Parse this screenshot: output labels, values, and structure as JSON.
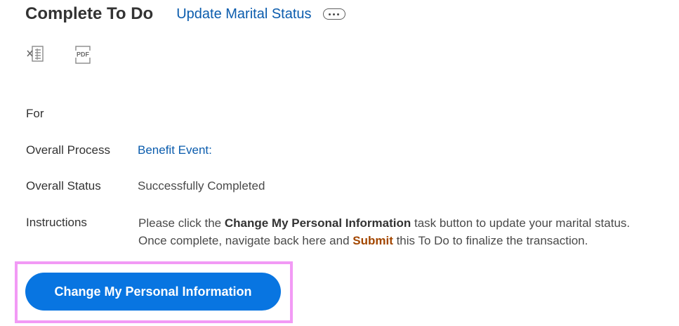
{
  "header": {
    "title": "Complete To Do",
    "subject_link": "Update Marital Status",
    "related_actions_icon": "more-horizontal-icon"
  },
  "export": {
    "excel_icon": "export-to-excel-icon",
    "pdf_icon": "export-to-pdf-icon",
    "pdf_icon_text": "PDF"
  },
  "fields": {
    "for_label": "For",
    "for_value": "",
    "overall_process_label": "Overall Process",
    "overall_process_value": "Benefit Event:",
    "overall_status_label": "Overall Status",
    "overall_status_value": "Successfully Completed",
    "instructions_label": "Instructions"
  },
  "instructions": {
    "line1_prefix": "Please click the ",
    "line1_bold": "Change My Personal Information",
    "line1_suffix": " task button to update your marital status.",
    "line2_prefix": "Once complete, navigate back here and ",
    "line2_highlight": "Submit",
    "line2_suffix": " this To Do to finalize the transaction."
  },
  "actions": {
    "primary_button_label": "Change My Personal Information"
  },
  "colors": {
    "link": "#0b5cad",
    "primary_button": "#0875e1",
    "highlight_border": "#f29af5",
    "submit_emphasis": "#a34700"
  }
}
